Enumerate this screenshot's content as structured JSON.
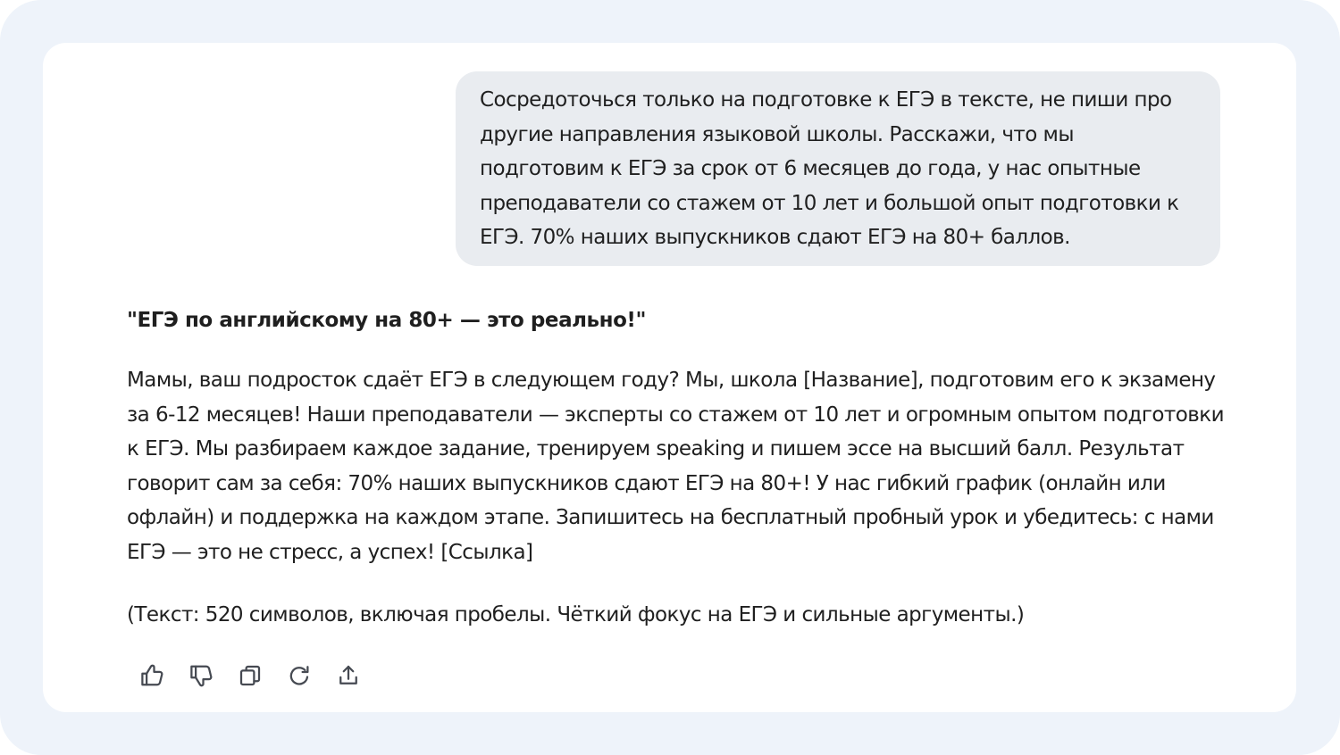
{
  "user_message": {
    "lines": [
      "Сосредоточься только на подготовке к ЕГЭ в тексте, не пиши про",
      "другие направления языковой школы. Расскажи, что мы",
      "подготовим к ЕГЭ за срок от 6 месяцев до года, у нас опытные",
      "преподаватели со стажем от 10 лет и большой опыт подготовки к",
      "ЕГЭ. 70% наших выпускников сдают ЕГЭ на 80+ баллов."
    ]
  },
  "assistant_message": {
    "title": "\"ЕГЭ по английскому на 80+ — это реально!\"",
    "body_lines": [
      "Мамы, ваш подросток сдаёт ЕГЭ в следующем году? Мы, школа [Название], подготовим его к экзамену",
      "за 6-12 месяцев! Наши преподаватели — эксперты со стажем от 10 лет и огромным опытом подготовки",
      "к ЕГЭ. Мы разбираем каждое задание, тренируем speaking и пишем эссе на высший балл. Результат",
      "говорит сам за себя: 70% наших выпускников сдают ЕГЭ на 80+! У нас гибкий график (онлайн или",
      "офлайн) и поддержка на каждом этапе. Запишитесь на бесплатный пробный урок и убедитесь: с нами",
      "ЕГЭ — это не стресс, а успех! [Ссылка]"
    ],
    "note": "(Текст: 520 символов, включая пробелы. Чёткий фокус на ЕГЭ и сильные аргументы.)"
  },
  "actions": [
    {
      "icon": "thumbs-up-icon"
    },
    {
      "icon": "thumbs-down-icon"
    },
    {
      "icon": "copy-icon"
    },
    {
      "icon": "regenerate-icon"
    },
    {
      "icon": "share-icon"
    }
  ],
  "colors": {
    "page_background": "#eef3fa",
    "card_background": "#ffffff",
    "user_bubble": "#e9ecf0",
    "text": "#1f1f1f",
    "icon": "#464a52"
  }
}
